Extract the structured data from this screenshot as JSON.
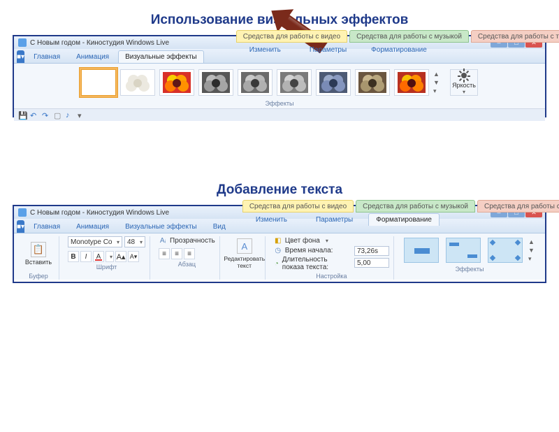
{
  "headings": {
    "visual_effects": "Использование визуальных эффектов",
    "text": "Добавление текста"
  },
  "window1": {
    "title": "С Новым годом - Киностудия Windows Live",
    "tabs": {
      "app": "■▾",
      "home": "Главная",
      "anim": "Анимация",
      "vfx": "Визуальные эффекты",
      "ctx_video": "Средства для работы с видео",
      "ctx_music": "Средства для работы с музыкой",
      "ctx_text": "Средства для работы с текстом",
      "sub_edit": "Изменить",
      "sub_params": "Параметры",
      "sub_format": "Форматирование"
    },
    "groups": {
      "effects": "Эффекты",
      "brightness": "Яркость"
    }
  },
  "window2": {
    "title": "С Новым годом - Киностудия Windows Live",
    "tabs": {
      "app": "■▾",
      "home": "Главная",
      "anim": "Анимация",
      "vfx": "Визуальные эффекты",
      "view": "Вид",
      "ctx_video": "Средства для работы с видео",
      "ctx_music": "Средства для работы с музыкой",
      "ctx_text": "Средства для работы с текстом",
      "sub_edit": "Изменить",
      "sub_params": "Параметры",
      "sub_format": "Форматирование"
    },
    "paste": "Вставить",
    "font_name": "Monotype Co",
    "font_size": "48",
    "transparency": "Прозрачность",
    "edit_text": "Редактировать текст",
    "bg_color": "Цвет фона",
    "start_time_label": "Время начала:",
    "start_time_value": "73,26s",
    "duration_label": "Длительность показа текста:",
    "duration_value": "5,00",
    "groups": {
      "buffer": "Буфер",
      "font": "Шрифт",
      "para": "Абзац",
      "settings": "Настройка",
      "effects": "Эффекты"
    }
  }
}
